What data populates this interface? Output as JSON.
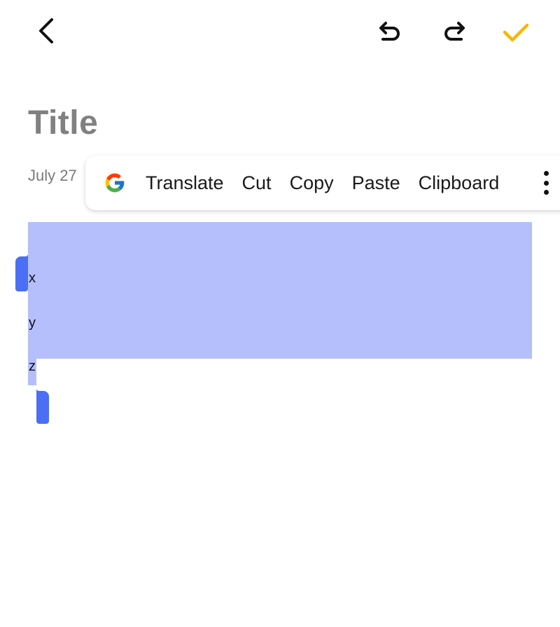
{
  "toolbar": {
    "back_icon": "back-arrow-icon",
    "undo_icon": "undo-icon",
    "redo_icon": "redo-icon",
    "confirm_icon": "checkmark-icon",
    "confirm_color": "#f5b800"
  },
  "note": {
    "title_placeholder": "Title",
    "date": "July 27",
    "lines": [
      "x",
      "y",
      "z"
    ]
  },
  "context_menu": {
    "logo_icon": "google-g-icon",
    "items": [
      "Translate",
      "Cut",
      "Copy",
      "Paste",
      "Clipboard"
    ],
    "more_icon": "more-vertical-icon"
  },
  "selection_color": "#b4bffb",
  "handle_color": "#4a6ff5"
}
